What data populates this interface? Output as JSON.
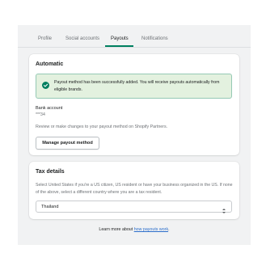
{
  "tabs": [
    {
      "label": "Profile"
    },
    {
      "label": "Social accounts"
    },
    {
      "label": "Payouts",
      "active": true
    },
    {
      "label": "Notifications"
    }
  ],
  "automatic": {
    "title": "Automatic",
    "banner_text": "Payout method has been successfully added. You will receive payouts automatically from eligible brands.",
    "bank_label": "Bank account",
    "bank_value": "***34",
    "review_text": "Review or make changes to your payout method on Shopify Partners.",
    "button_label": "Manage payout method"
  },
  "tax": {
    "title": "Tax details",
    "description": "Select United States if you're a US citizen, US resident or have your business organized in the US. If none of the above, select a different country where you are a tax resident.",
    "selected_country": "Thailand"
  },
  "footer": {
    "prefix": "Learn more about ",
    "link_text": "how payouts work",
    "suffix": "."
  },
  "colors": {
    "accent": "#008060",
    "success_bg": "#e3f1df",
    "link": "#2c6ecb"
  }
}
